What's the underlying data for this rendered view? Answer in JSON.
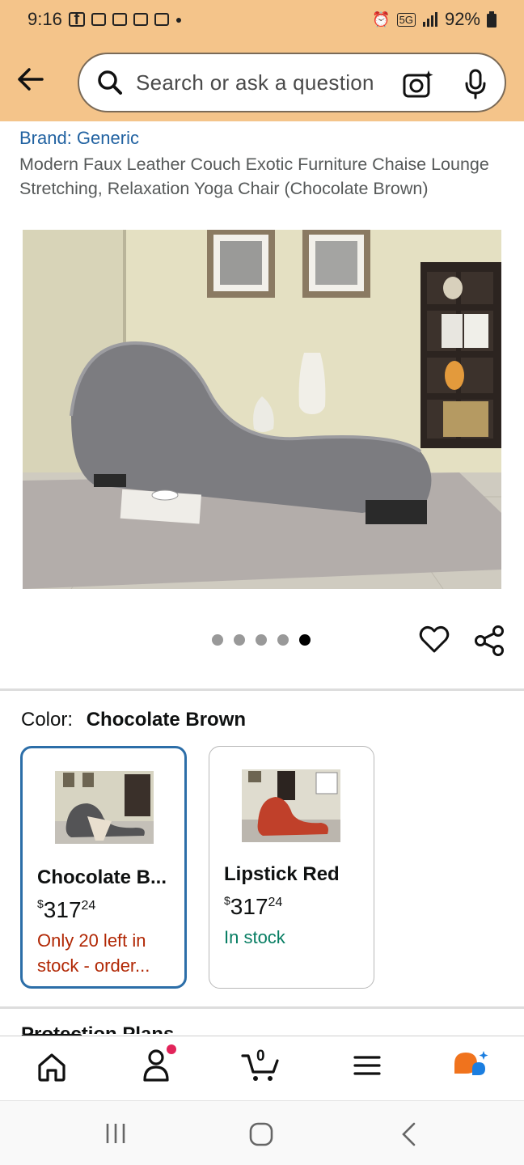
{
  "status_bar": {
    "time": "9:16",
    "battery": "92%",
    "network": "5G"
  },
  "search": {
    "placeholder": "Search or ask a question"
  },
  "product": {
    "brand": "Brand: Generic",
    "title": "Modern Faux Leather Couch Exotic Furniture Chaise Lounge Stretching, Relaxation Yoga Chair (Chocolate Brown)",
    "image_count": 5,
    "active_image_index": 4
  },
  "color": {
    "label": "Color:",
    "selected": "Chocolate Brown",
    "options": [
      {
        "name": "Chocolate B...",
        "price_symbol": "$",
        "price_whole": "317",
        "price_cents": "24",
        "availability": "Only 20 left in stock - order...",
        "availability_status": "low",
        "selected": true
      },
      {
        "name": "Lipstick Red",
        "price_symbol": "$",
        "price_whole": "317",
        "price_cents": "24",
        "availability": "In stock",
        "availability_status": "in-stock",
        "selected": false
      }
    ]
  },
  "protection": {
    "heading": "Protection Plans"
  },
  "bottom_nav": {
    "cart_count": "0",
    "items": [
      "home-icon",
      "account-icon",
      "cart-icon",
      "menu-icon",
      "rufus-icon"
    ]
  },
  "colors": {
    "header_bg": "#f4c48a",
    "link_blue": "#2162a1",
    "selected_border": "#2c6ea8",
    "price_red": "#b12704",
    "stock_green": "#067d62"
  }
}
